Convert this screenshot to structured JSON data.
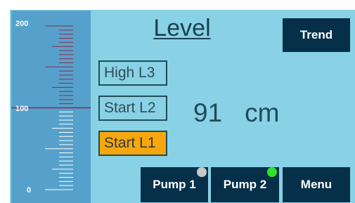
{
  "title": "Level",
  "trend_label": "Trend",
  "stages": [
    {
      "label": "High L3",
      "active": false
    },
    {
      "label": "Start L2",
      "active": false
    },
    {
      "label": "Start L1",
      "active": true
    }
  ],
  "level": {
    "value": "91",
    "unit": "cm"
  },
  "scale": {
    "labels": [
      "200",
      "100",
      "0"
    ],
    "max": 200,
    "min": 0,
    "current": 100
  },
  "pumps": [
    {
      "label": "Pump 1",
      "status_color": "#c8c8c8"
    },
    {
      "label": "Pump 2",
      "status_color": "#2ee22a"
    }
  ],
  "menu_label": "Menu",
  "colors": {
    "panel": "#89d1e5",
    "gauge": "#56a1cc",
    "button": "#06304a",
    "active_stage": "#f7a70d",
    "level_line": "#8a2a4a"
  }
}
